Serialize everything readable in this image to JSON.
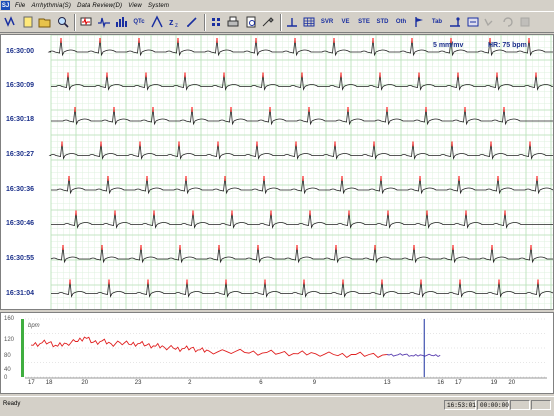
{
  "app": {
    "icon_label": "SJ"
  },
  "menu": [
    {
      "label": "File"
    },
    {
      "label": "Arrhythmia(S)"
    },
    {
      "label": "Data Review(D)"
    },
    {
      "label": "View"
    },
    {
      "label": "System"
    }
  ],
  "toolbar": {
    "text_buttons": {
      "qtc": "QTc",
      "svr": "SVR",
      "ve": "VE",
      "ste": "STE",
      "std": "STD",
      "oth": "Oth",
      "tab": "Tab"
    },
    "icons": [
      "save-icon",
      "new-file-icon",
      "open-icon",
      "search-icon",
      "monitor-icon",
      "rhythm-icon",
      "bar-chart-icon",
      "qtc-icon",
      "signal-icon",
      "zoom-icon",
      "grid-icon",
      "print-icon",
      "preview-icon",
      "tools-icon",
      "mark-icon",
      "table-icon",
      "flag-icon",
      "settings-icon",
      "export-icon",
      "save-disk-icon"
    ]
  },
  "ecg": {
    "gain_label": "5 mm/mv",
    "hr_label": "HR: 75 bpm",
    "strips": [
      {
        "time": "16:30:00"
      },
      {
        "time": "16:30:09"
      },
      {
        "time": "16:30:18"
      },
      {
        "time": "16:30:27"
      },
      {
        "time": "16:30:36"
      },
      {
        "time": "16:30:46"
      },
      {
        "time": "16:30:55"
      },
      {
        "time": "16:31:04"
      }
    ],
    "colors": {
      "grid": "#b7e0b7",
      "trace": "#222222",
      "marker": "#ff2020",
      "time": "#1a2f8a"
    }
  },
  "chart_data": {
    "type": "line",
    "title": "",
    "ylabel": "bpm",
    "y_ticks": [
      "160",
      "120",
      "80",
      "40",
      "0"
    ],
    "ylim": [
      0,
      160
    ],
    "x_ticks": [
      "17",
      "18",
      "19",
      "20",
      "21",
      "22",
      "23",
      "0",
      "1",
      "2",
      "3",
      "4",
      "5",
      "6",
      "7",
      "8",
      "9",
      "10",
      "11",
      "12",
      "13",
      "14",
      "15",
      "16",
      "17",
      "18",
      "19",
      "20",
      "21",
      "22"
    ],
    "x_ticks_printed": [
      "17",
      "18",
      "20",
      "23",
      "2",
      "6",
      "9",
      "13",
      "16",
      "17",
      "19",
      "20"
    ],
    "series": [
      {
        "color": "#e02020",
        "x": [
          17,
          17.5,
          18,
          18.5,
          19,
          19.5,
          20,
          20.5,
          21,
          21.5,
          22,
          22.5,
          23,
          23.5,
          0,
          0.5,
          1,
          1.5,
          2,
          2.5,
          3,
          4,
          5,
          6,
          7,
          8,
          9,
          10,
          11,
          12,
          13
        ],
        "values": [
          88,
          92,
          95,
          85,
          92,
          98,
          110,
          96,
          100,
          92,
          95,
          90,
          92,
          88,
          85,
          82,
          80,
          78,
          80,
          75,
          72,
          70,
          68,
          66,
          66,
          64,
          64,
          62,
          62,
          62,
          62
        ]
      },
      {
        "color": "#5a3fb0",
        "x": [
          13,
          13.5,
          14,
          14.5,
          15,
          15.5,
          16
        ],
        "values": [
          62,
          60,
          62,
          58,
          60,
          60,
          60
        ]
      }
    ],
    "annotation": "15",
    "status_values": {
      "time": "16:53:01",
      "duration": "00:00:00"
    }
  },
  "status": {
    "ready": "Ready",
    "field1": "16:53:01",
    "field2": "00:00:00",
    "field3": "",
    "field4": ""
  }
}
